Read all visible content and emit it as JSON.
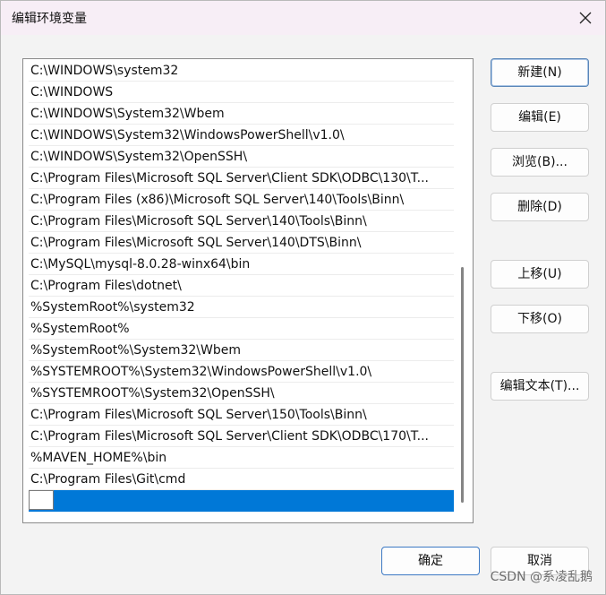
{
  "window": {
    "title": "编辑环境变量",
    "close_icon": "close-icon"
  },
  "paths": [
    "C:\\WINDOWS\\system32",
    "C:\\WINDOWS",
    "C:\\WINDOWS\\System32\\Wbem",
    "C:\\WINDOWS\\System32\\WindowsPowerShell\\v1.0\\",
    "C:\\WINDOWS\\System32\\OpenSSH\\",
    "C:\\Program Files\\Microsoft SQL Server\\Client SDK\\ODBC\\130\\T...",
    "C:\\Program Files (x86)\\Microsoft SQL Server\\140\\Tools\\Binn\\",
    "C:\\Program Files\\Microsoft SQL Server\\140\\Tools\\Binn\\",
    "C:\\Program Files\\Microsoft SQL Server\\140\\DTS\\Binn\\",
    "C:\\MySQL\\mysql-8.0.28-winx64\\bin",
    "C:\\Program Files\\dotnet\\",
    "%SystemRoot%\\system32",
    "%SystemRoot%",
    "%SystemRoot%\\System32\\Wbem",
    "%SYSTEMROOT%\\System32\\WindowsPowerShell\\v1.0\\",
    "%SYSTEMROOT%\\System32\\OpenSSH\\",
    "C:\\Program Files\\Microsoft SQL Server\\150\\Tools\\Binn\\",
    "C:\\Program Files\\Microsoft SQL Server\\Client SDK\\ODBC\\170\\T...",
    "%MAVEN_HOME%\\bin",
    "C:\\Program Files\\Git\\cmd"
  ],
  "new_entry_value": "",
  "buttons": {
    "new": "新建(N)",
    "edit": "编辑(E)",
    "browse": "浏览(B)...",
    "delete": "删除(D)",
    "move_up": "上移(U)",
    "move_down": "下移(O)",
    "edit_text": "编辑文本(T)...",
    "ok": "确定",
    "cancel": "取消"
  },
  "colors": {
    "selection": "#0078d7",
    "title_bg": "#f7eef6"
  },
  "watermark": "CSDN @系凌乱鹅"
}
